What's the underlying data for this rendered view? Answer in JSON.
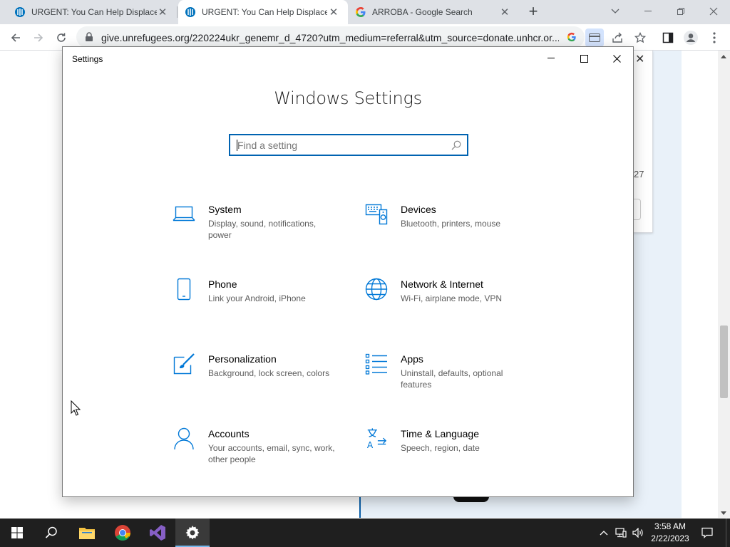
{
  "browser": {
    "tabs": [
      {
        "title": "URGENT: You Can Help Displaced",
        "favicon": "unhcr-icon",
        "active": false
      },
      {
        "title": "URGENT: You Can Help Displaced",
        "favicon": "unhcr-icon",
        "active": true
      },
      {
        "title": "ARROBA - Google Search",
        "favicon": "google-icon",
        "active": false
      }
    ],
    "url": "give.unrefugees.org/220224ukr_genemr_d_4720?utm_medium=referral&utm_source=donate.unhcr.or..."
  },
  "background_page": {
    "card_number_fragment": "27"
  },
  "settings": {
    "window_title": "Settings",
    "heading": "Windows Settings",
    "search_placeholder": "Find a setting",
    "categories": [
      {
        "name": "System",
        "desc": "Display, sound, notifications, power",
        "icon": "laptop-icon"
      },
      {
        "name": "Devices",
        "desc": "Bluetooth, printers, mouse",
        "icon": "devices-icon"
      },
      {
        "name": "Phone",
        "desc": "Link your Android, iPhone",
        "icon": "phone-icon"
      },
      {
        "name": "Network & Internet",
        "desc": "Wi-Fi, airplane mode, VPN",
        "icon": "globe-icon"
      },
      {
        "name": "Personalization",
        "desc": "Background, lock screen, colors",
        "icon": "paintbrush-icon"
      },
      {
        "name": "Apps",
        "desc": "Uninstall, defaults, optional features",
        "icon": "apps-list-icon"
      },
      {
        "name": "Accounts",
        "desc": "Your accounts, email, sync, work, other people",
        "icon": "person-icon"
      },
      {
        "name": "Time & Language",
        "desc": "Speech, region, date",
        "icon": "time-language-icon"
      }
    ]
  },
  "taskbar": {
    "apps": [
      "windows-start-icon",
      "search-icon",
      "file-explorer-icon",
      "chrome-icon",
      "visual-studio-icon",
      "settings-gear-icon"
    ],
    "time": "3:58 AM",
    "date": "2/22/2023"
  },
  "colors": {
    "accent": "#0063b1",
    "icon_blue": "#0078d7",
    "taskbar": "#1f1f1f",
    "chrome_strip": "#dee1e6"
  }
}
